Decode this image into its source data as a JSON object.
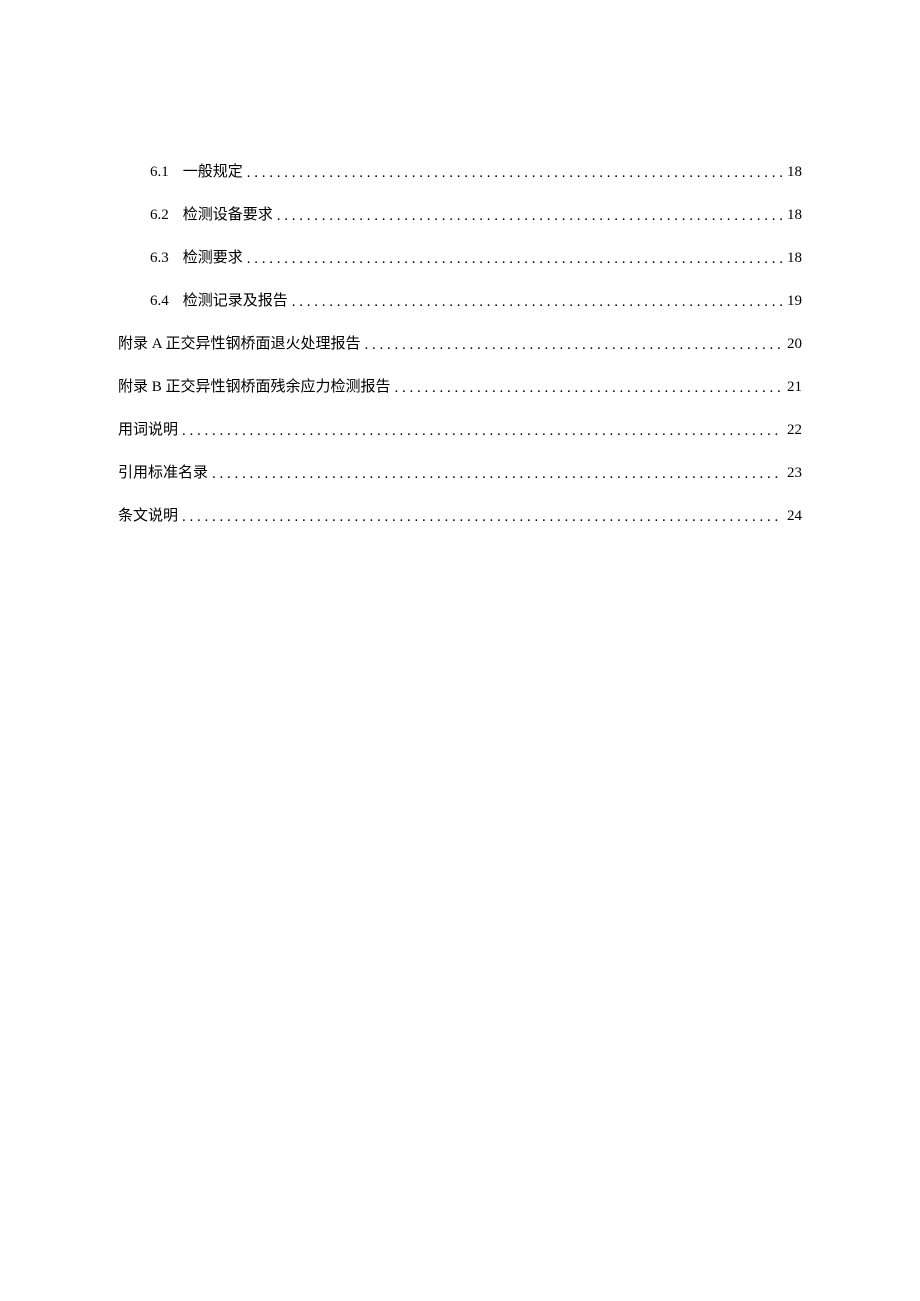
{
  "toc": {
    "sub_entries": [
      {
        "number": "6.1",
        "title": "一般规定",
        "page": "18"
      },
      {
        "number": "6.2",
        "title": "检测设备要求",
        "page": "18"
      },
      {
        "number": "6.3",
        "title": "检测要求",
        "page": "18"
      },
      {
        "number": "6.4",
        "title": "检测记录及报告",
        "page": "19"
      }
    ],
    "main_entries": [
      {
        "title": "附录 A 正交异性钢桥面退火处理报告",
        "page": "20"
      },
      {
        "title": "附录 B 正交异性钢桥面残余应力检测报告",
        "page": "21"
      },
      {
        "title": "用词说明",
        "page": "22"
      },
      {
        "title": "引用标准名录",
        "page": "23"
      },
      {
        "title": "条文说明",
        "page": "24"
      }
    ]
  }
}
